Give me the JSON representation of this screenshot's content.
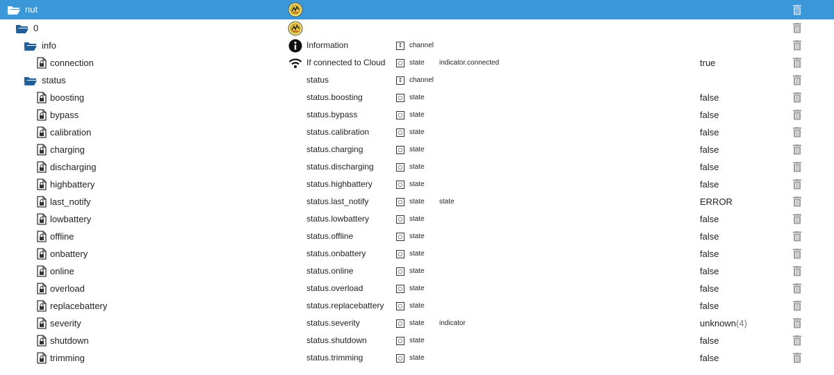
{
  "tree": {
    "rows": [
      {
        "name": "nut",
        "title": "",
        "type": "",
        "role": "",
        "value": "",
        "unit": "",
        "icon": "folder-open-icon",
        "depth": 0,
        "logo": true,
        "selected": true
      },
      {
        "name": "0",
        "title": "",
        "type": "",
        "role": "",
        "value": "",
        "unit": "",
        "icon": "folder-open-icon",
        "depth": 1,
        "logo": true
      },
      {
        "name": "info",
        "title": "Information",
        "type": "channel",
        "role": "",
        "value": "",
        "unit": "",
        "icon": "folder-open-icon",
        "depth": 2,
        "role_icon": "info-icon"
      },
      {
        "name": "connection",
        "title": "If connected to Cloud",
        "type": "state",
        "role": "indicator.connected",
        "value": "true",
        "unit": "",
        "icon": "file-icon",
        "depth": 3,
        "role_icon": "wifi-icon"
      },
      {
        "name": "status",
        "title": "status",
        "type": "channel",
        "role": "",
        "value": "",
        "unit": "",
        "icon": "folder-open-icon",
        "depth": 2
      },
      {
        "name": "boosting",
        "title": "status.boosting",
        "type": "state",
        "role": "",
        "value": "false",
        "unit": "",
        "icon": "file-icon",
        "depth": 3
      },
      {
        "name": "bypass",
        "title": "status.bypass",
        "type": "state",
        "role": "",
        "value": "false",
        "unit": "",
        "icon": "file-icon",
        "depth": 3
      },
      {
        "name": "calibration",
        "title": "status.calibration",
        "type": "state",
        "role": "",
        "value": "false",
        "unit": "",
        "icon": "file-icon",
        "depth": 3
      },
      {
        "name": "charging",
        "title": "status.charging",
        "type": "state",
        "role": "",
        "value": "false",
        "unit": "",
        "icon": "file-icon",
        "depth": 3
      },
      {
        "name": "discharging",
        "title": "status.discharging",
        "type": "state",
        "role": "",
        "value": "false",
        "unit": "",
        "icon": "file-icon",
        "depth": 3
      },
      {
        "name": "highbattery",
        "title": "status.highbattery",
        "type": "state",
        "role": "",
        "value": "false",
        "unit": "",
        "icon": "file-icon",
        "depth": 3
      },
      {
        "name": "last_notify",
        "title": "status.last_notify",
        "type": "state",
        "role": "state",
        "value": "ERROR",
        "unit": "",
        "icon": "file-icon",
        "depth": 3
      },
      {
        "name": "lowbattery",
        "title": "status.lowbattery",
        "type": "state",
        "role": "",
        "value": "false",
        "unit": "",
        "icon": "file-icon",
        "depth": 3
      },
      {
        "name": "offline",
        "title": "status.offline",
        "type": "state",
        "role": "",
        "value": "false",
        "unit": "",
        "icon": "file-icon",
        "depth": 3
      },
      {
        "name": "onbattery",
        "title": "status.onbattery",
        "type": "state",
        "role": "",
        "value": "false",
        "unit": "",
        "icon": "file-icon",
        "depth": 3
      },
      {
        "name": "online",
        "title": "status.online",
        "type": "state",
        "role": "",
        "value": "false",
        "unit": "",
        "icon": "file-icon",
        "depth": 3
      },
      {
        "name": "overload",
        "title": "status.overload",
        "type": "state",
        "role": "",
        "value": "false",
        "unit": "",
        "icon": "file-icon",
        "depth": 3
      },
      {
        "name": "replacebattery",
        "title": "status.replacebattery",
        "type": "state",
        "role": "",
        "value": "false",
        "unit": "",
        "icon": "file-icon",
        "depth": 3
      },
      {
        "name": "severity",
        "title": "status.severity",
        "type": "state",
        "role": "indicator",
        "value": "unknown",
        "unit": "(4)",
        "icon": "file-icon",
        "depth": 3
      },
      {
        "name": "shutdown",
        "title": "status.shutdown",
        "type": "state",
        "role": "",
        "value": "false",
        "unit": "",
        "icon": "file-icon",
        "depth": 3
      },
      {
        "name": "trimming",
        "title": "status.trimming",
        "type": "state",
        "role": "",
        "value": "false",
        "unit": "",
        "icon": "file-icon",
        "depth": 3
      }
    ]
  },
  "colors": {
    "selected_bg": "#3a98d8",
    "folder": "#1f5f99",
    "delete": "#9a9a9a"
  }
}
